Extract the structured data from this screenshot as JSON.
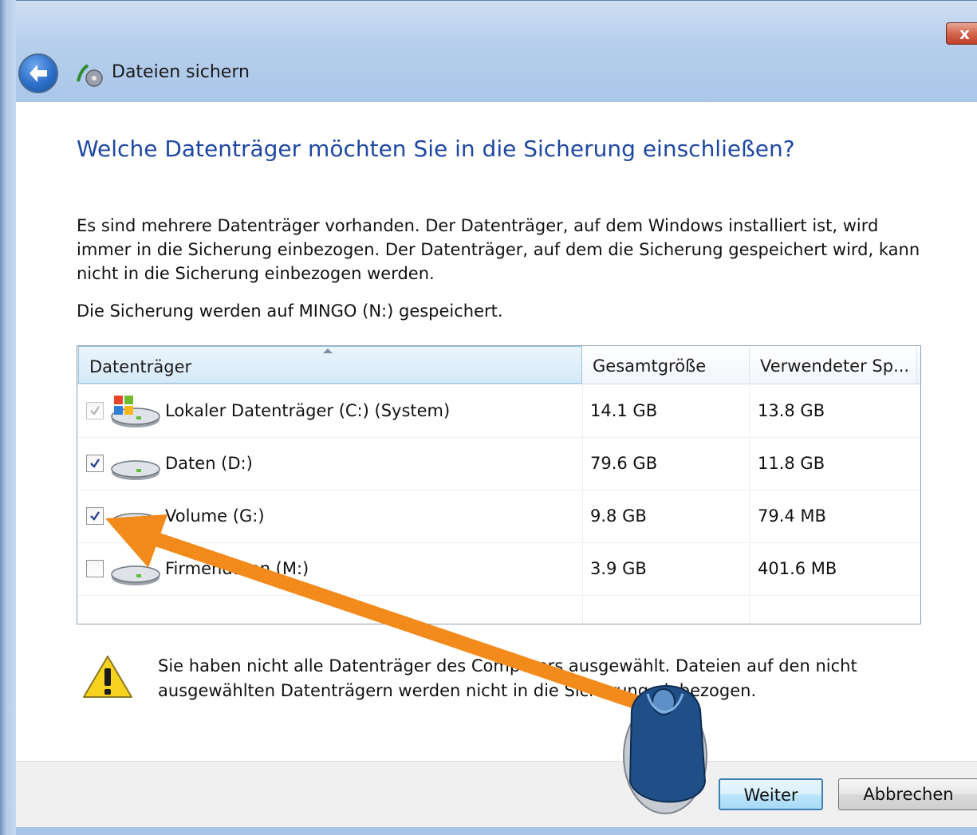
{
  "window": {
    "title": "Dateien sichern",
    "close_label": "x"
  },
  "main": {
    "heading": "Welche Datenträger möchten Sie in die Sicherung einschließen?",
    "description": "Es sind mehrere Datenträger vorhanden. Der Datenträger, auf dem Windows installiert ist, wird immer in die Sicherung einbezogen. Der Datenträger, auf dem die Sicherung gespeichert wird, kann nicht in die Sicherung einbezogen werden.",
    "save_info": "Die Sicherung werden auf MINGO (N:) gespeichert."
  },
  "table": {
    "columns": [
      "Datenträger",
      "Gesamtgröße",
      "Verwendeter Sp..."
    ],
    "rows": [
      {
        "name": "Lokaler Datenträger (C:) (System)",
        "size": "14.1 GB",
        "used": "13.8 GB",
        "checked": true,
        "disabled": true,
        "icon": "system-drive-icon"
      },
      {
        "name": "Daten (D:)",
        "size": "79.6 GB",
        "used": "11.8 GB",
        "checked": true,
        "disabled": false,
        "icon": "drive-icon"
      },
      {
        "name": "Volume (G:)",
        "size": "9.8 GB",
        "used": "79.4 MB",
        "checked": true,
        "disabled": false,
        "icon": "drive-icon"
      },
      {
        "name": "Firmendaten (M:)",
        "size": "3.9 GB",
        "used": "401.6 MB",
        "checked": false,
        "disabled": false,
        "icon": "drive-icon"
      }
    ]
  },
  "warning": {
    "text": "Sie haben nicht alle Datenträger des Computers ausgewählt. Dateien auf den nicht ausgewählten Datenträgern werden nicht in die Sicherung einbezogen."
  },
  "footer": {
    "next_label": "Weiter",
    "cancel_label": "Abbrechen"
  },
  "colors": {
    "heading": "#1f48a3",
    "arrow": "#f28a1c",
    "mouse": "#1f4f86"
  }
}
